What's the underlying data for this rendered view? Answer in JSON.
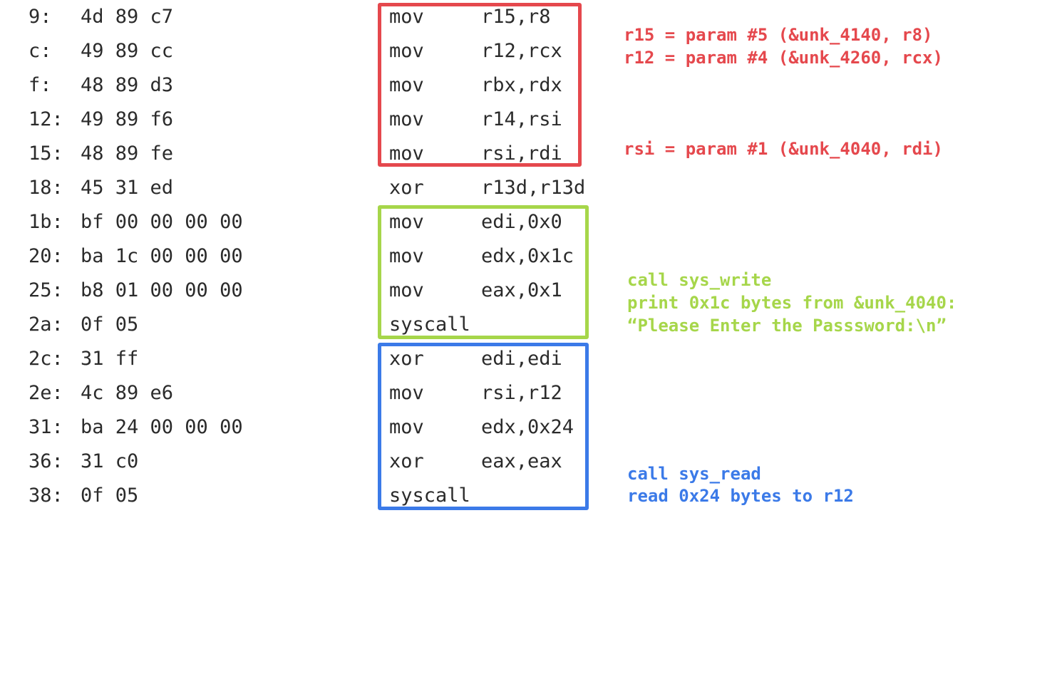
{
  "colors": {
    "text": "#2b2b2b",
    "red": "#e5484d",
    "green": "#a6d64a",
    "blue": "#3b7ae8"
  },
  "rows": [
    {
      "addr": "9:",
      "bytes": "4d 89 c7",
      "mnemonic": "mov",
      "operands": "r15,r8"
    },
    {
      "addr": "c:",
      "bytes": "49 89 cc",
      "mnemonic": "mov",
      "operands": "r12,rcx"
    },
    {
      "addr": "f:",
      "bytes": "48 89 d3",
      "mnemonic": "mov",
      "operands": "rbx,rdx"
    },
    {
      "addr": "12:",
      "bytes": "49 89 f6",
      "mnemonic": "mov",
      "operands": "r14,rsi"
    },
    {
      "addr": "15:",
      "bytes": "48 89 fe",
      "mnemonic": "mov",
      "operands": "rsi,rdi"
    },
    {
      "addr": "18:",
      "bytes": "45 31 ed",
      "mnemonic": "xor",
      "operands": "r13d,r13d"
    },
    {
      "addr": "1b:",
      "bytes": "bf 00 00 00 00",
      "mnemonic": "mov",
      "operands": "edi,0x0"
    },
    {
      "addr": "20:",
      "bytes": "ba 1c 00 00 00",
      "mnemonic": "mov",
      "operands": "edx,0x1c"
    },
    {
      "addr": "25:",
      "bytes": "b8 01 00 00 00",
      "mnemonic": "mov",
      "operands": "eax,0x1"
    },
    {
      "addr": "2a:",
      "bytes": "0f 05",
      "mnemonic": "syscall",
      "operands": ""
    },
    {
      "addr": "2c:",
      "bytes": "31 ff",
      "mnemonic": "xor",
      "operands": "edi,edi"
    },
    {
      "addr": "2e:",
      "bytes": "4c 89 e6",
      "mnemonic": "mov",
      "operands": "rsi,r12"
    },
    {
      "addr": "31:",
      "bytes": "ba 24 00 00 00",
      "mnemonic": "mov",
      "operands": "edx,0x24"
    },
    {
      "addr": "36:",
      "bytes": "31 c0",
      "mnemonic": "xor",
      "operands": "eax,eax"
    },
    {
      "addr": "38:",
      "bytes": "0f 05",
      "mnemonic": "syscall",
      "operands": ""
    }
  ],
  "notes": {
    "red": [
      "r15 = param #5 (&unk_4140, r8)",
      "r12 = param #4 (&unk_4260, rcx)",
      "rsi = param #1 (&unk_4040, rdi)"
    ],
    "green": [
      "call sys_write",
      "print 0x1c bytes from &unk_4040:",
      "“Please Enter the Passsword:\\n”"
    ],
    "blue": [
      "call sys_read",
      "read 0x24 bytes to r12"
    ]
  }
}
